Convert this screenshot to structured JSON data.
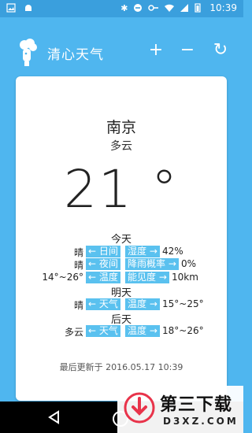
{
  "status_bar": {
    "time": "10:39"
  },
  "app": {
    "title": "清心天气"
  },
  "actions": {
    "add": "+",
    "remove": "−",
    "refresh": "↻"
  },
  "weather": {
    "city": "南京",
    "condition": "多云",
    "temperature": "21 °",
    "today": {
      "label": "今天",
      "rows": [
        {
          "value": "晴",
          "tag1": "← 日间",
          "tag2": "湿度 →",
          "rvalue": "42%"
        },
        {
          "value": "晴",
          "tag1": "← 夜间",
          "tag2": "降雨概率 →",
          "rvalue": "0%"
        },
        {
          "value": "14°~26°",
          "tag1": "← 温度",
          "tag2": "能见度 →",
          "rvalue": "10km"
        }
      ]
    },
    "tomorrow": {
      "label": "明天",
      "row": {
        "value": "晴",
        "tag1": "← 天气",
        "tag2": "温度 →",
        "rvalue": "15°~25°"
      }
    },
    "after_tomorrow": {
      "label": "后天",
      "row": {
        "value": "多云",
        "tag1": "← 天气",
        "tag2": "温度 →",
        "rvalue": "18°~26°"
      }
    },
    "updated": "最后更新于 2016.05.17 10:39"
  },
  "pager": {
    "count": 2,
    "active": 1
  },
  "watermark": {
    "title": "第三下载",
    "domain": "D3XZ.COM"
  },
  "colors": {
    "primary": "#4fb6ef",
    "status": "#3a9fdd",
    "tag": "#5ac1ef",
    "card": "#ffffff"
  }
}
